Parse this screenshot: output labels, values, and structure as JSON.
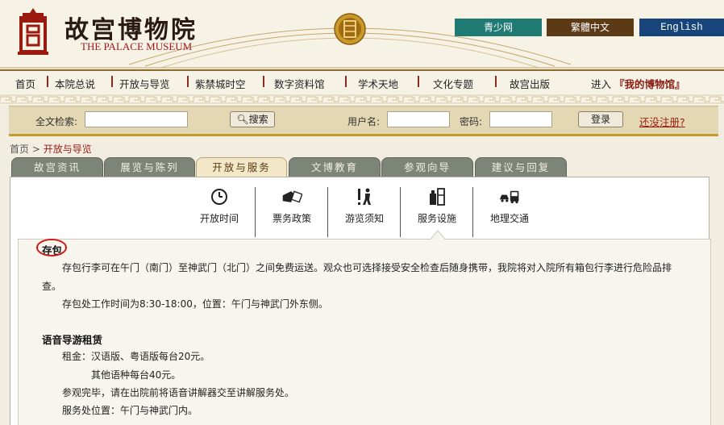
{
  "header": {
    "logo_cn": "故宫博物院",
    "logo_en": "THE PALACE MUSEUM",
    "lang_links": [
      "青少网",
      "繁體中文",
      "English"
    ]
  },
  "nav": {
    "items": [
      "首页",
      "本院总说",
      "开放与导览",
      "紫禁城时空",
      "数字资料馆",
      "学术天地",
      "文化专题",
      "故宫出版"
    ],
    "enter_label": "进入",
    "my_museum": "『我的博物馆』"
  },
  "search_bar": {
    "search_label": "全文检索:",
    "search_button": "搜索",
    "username_label": "用户名:",
    "password_label": "密码:",
    "login_button": "登录",
    "register_link": "还没注册?"
  },
  "breadcrumb": {
    "home": "首页",
    "separator": ">",
    "current": "开放与导览"
  },
  "tabs": [
    "故宫资讯",
    "展览与陈列",
    "开放与服务",
    "文博教育",
    "参观向导",
    "建议与回复"
  ],
  "subnav": [
    "开放时间",
    "票务政策",
    "游览须知",
    "服务设施",
    "地理交通"
  ],
  "content": {
    "section1_title": "存包",
    "section1_p1_line1": "存包行李可在午门（南门）至神武门（北门）之间免费运送。观众也可选择接受安全检查后随身携带，我院将对入院所有箱包行李进行危险品排",
    "section1_p1_line2": "查。",
    "section1_p2": "存包处工作时间为8:30-18:00，位置：午门与神武门外东侧。",
    "section2_title": "语音导游租赁",
    "section2_p1": "租金：汉语版、粤语版每台20元。",
    "section2_p2": "其他语种每台40元。",
    "section2_p3": "参观完毕，请在出院前将语音讲解器交至讲解服务处。",
    "section2_p4": "服务处位置：午门与神武门内。"
  },
  "colors": {
    "lang_teal": "#1f7a73",
    "lang_brown": "#5c3a16",
    "lang_blue": "#17447a",
    "accent_red": "#9a1a10",
    "tab_gray": "#7d8579",
    "tab_active": "#f2e8c8"
  }
}
